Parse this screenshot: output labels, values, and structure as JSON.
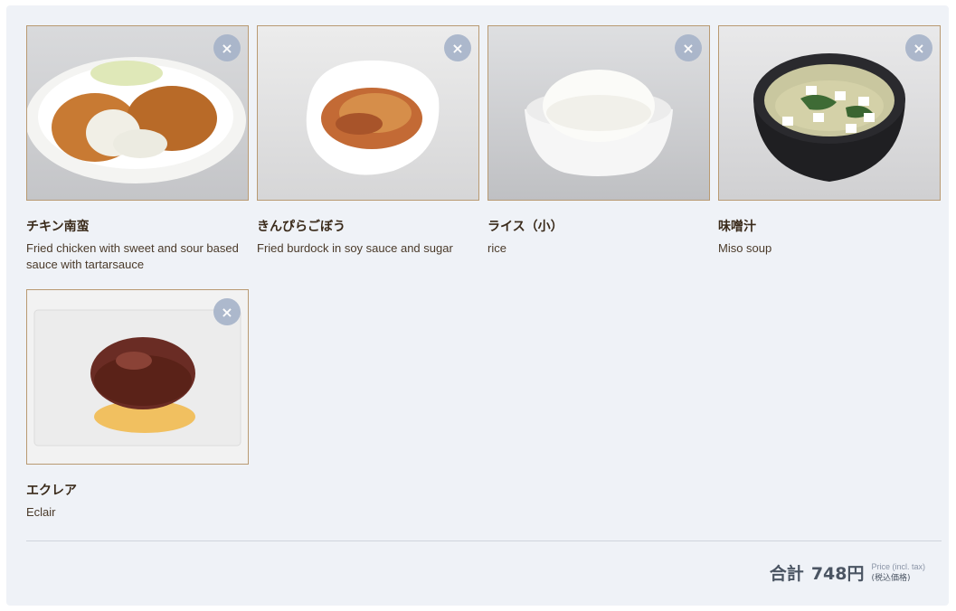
{
  "cart": {
    "items": [
      {
        "name": "チキン南蛮",
        "description": "Fried chicken with sweet and sour based sauce with tartarsauce",
        "image": "chicken-nanban-photo"
      },
      {
        "name": "きんぴらごぼう",
        "description": "Fried burdock in soy sauce and sugar",
        "image": "kinpira-gobo-photo"
      },
      {
        "name": "ライス（小）",
        "description": "rice",
        "image": "rice-bowl-photo"
      },
      {
        "name": "味噌汁",
        "description": "Miso soup",
        "image": "miso-soup-photo"
      },
      {
        "name": "エクレア",
        "description": "Eclair",
        "image": "eclair-photo"
      }
    ],
    "remove_icon": "×"
  },
  "summary": {
    "total_label": "合計",
    "total_amount": "748円",
    "tax_note_en": "Price (incl. tax)",
    "tax_note_ja": "(税込価格)"
  },
  "colors": {
    "panel_bg": "#eff2f7",
    "image_border": "#b99a72",
    "remove_button": "#a6b3c9",
    "item_name": "#3a2a1a",
    "total_text": "#4b5563"
  }
}
